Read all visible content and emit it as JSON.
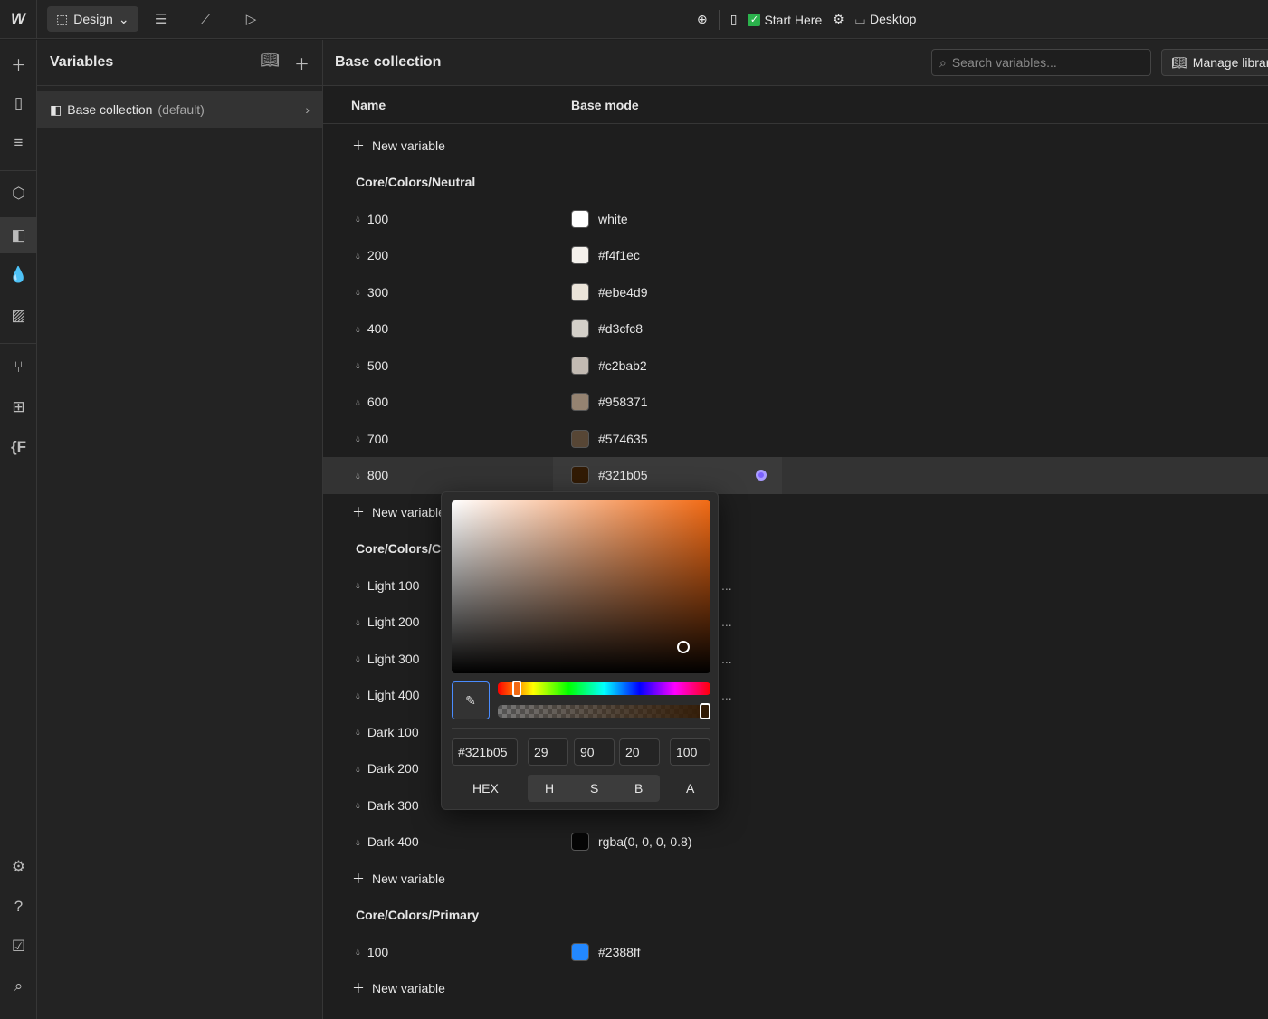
{
  "topbar": {
    "mode": "Design",
    "page": "Start Here",
    "breakpoint": "Desktop"
  },
  "panel": {
    "title": "Variables",
    "collection": "Base collection",
    "collection_tag": "(default)"
  },
  "main": {
    "title": "Base collection",
    "search_placeholder": "Search variables...",
    "manage": "Manage libraries",
    "col_name": "Name",
    "col_mode": "Base mode",
    "new_variable": "New variable"
  },
  "groups": [
    {
      "name": "Core/Colors/Neutral",
      "vars": [
        {
          "name": "100",
          "value": "white",
          "color": "#ffffff"
        },
        {
          "name": "200",
          "value": "#f4f1ec",
          "color": "#f4f1ec"
        },
        {
          "name": "300",
          "value": "#ebe4d9",
          "color": "#ebe4d9"
        },
        {
          "name": "400",
          "value": "#d3cfc8",
          "color": "#d3cfc8"
        },
        {
          "name": "500",
          "value": "#c2bab2",
          "color": "#c2bab2"
        },
        {
          "name": "600",
          "value": "#958371",
          "color": "#958371"
        },
        {
          "name": "700",
          "value": "#574635",
          "color": "#574635"
        },
        {
          "name": "800",
          "value": "#321b05",
          "color": "#321b05"
        }
      ]
    },
    {
      "name": "Core/Colors/C",
      "vars": [
        {
          "name": "Light 100"
        },
        {
          "name": "Light 200"
        },
        {
          "name": "Light 300"
        },
        {
          "name": "Light 400"
        },
        {
          "name": "Dark 100"
        },
        {
          "name": "Dark 200"
        },
        {
          "name": "Dark 300"
        },
        {
          "name": "Dark 400",
          "value": "rgba(0, 0, 0, 0.8)",
          "color": "rgba(0,0,0,0.8)"
        }
      ]
    },
    {
      "name": "Core/Colors/Primary",
      "vars": [
        {
          "name": "100",
          "value": "#2388ff",
          "color": "#2388ff"
        }
      ]
    }
  ],
  "picker": {
    "hex": "#321b05",
    "h": "29",
    "s": "90",
    "b": "20",
    "a": "100",
    "labels": {
      "hex": "HEX",
      "h": "H",
      "s": "S",
      "b": "B",
      "a": "A"
    },
    "hue_fraction": 0.08,
    "alpha_fraction": 1.0
  },
  "more": "..."
}
